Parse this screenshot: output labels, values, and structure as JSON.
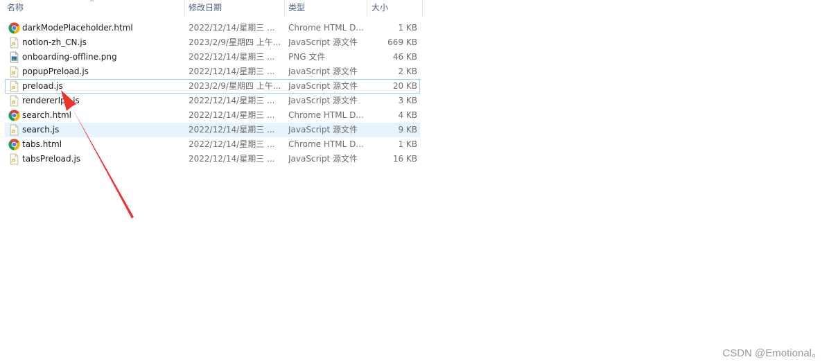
{
  "columns": {
    "name": "名称",
    "date": "修改日期",
    "type": "类型",
    "size": "大小"
  },
  "files": [
    {
      "name": "darkModePlaceholder.html",
      "date": "2022/12/14/星期三 ...",
      "type": "Chrome HTML D...",
      "size": "1 KB",
      "icon": "chrome-icon"
    },
    {
      "name": "notion-zh_CN.js",
      "date": "2023/2/9/星期四 上午...",
      "type": "JavaScript 源文件",
      "size": "669 KB",
      "icon": "js-file-icon"
    },
    {
      "name": "onboarding-offline.png",
      "date": "2022/12/14/星期三 ...",
      "type": "PNG 文件",
      "size": "46 KB",
      "icon": "image-file-icon"
    },
    {
      "name": "popupPreload.js",
      "date": "2022/12/14/星期三 ...",
      "type": "JavaScript 源文件",
      "size": "2 KB",
      "icon": "js-file-icon"
    },
    {
      "name": "preload.js",
      "date": "2023/2/9/星期四 上午...",
      "type": "JavaScript 源文件",
      "size": "20 KB",
      "icon": "js-file-icon",
      "state": "focus"
    },
    {
      "name": "rendererIpc.js",
      "date": "2022/12/14/星期三 ...",
      "type": "JavaScript 源文件",
      "size": "3 KB",
      "icon": "js-file-icon"
    },
    {
      "name": "search.html",
      "date": "2022/12/14/星期三 ...",
      "type": "Chrome HTML D...",
      "size": "4 KB",
      "icon": "chrome-icon"
    },
    {
      "name": "search.js",
      "date": "2022/12/14/星期三 ...",
      "type": "JavaScript 源文件",
      "size": "9 KB",
      "icon": "js-file-icon",
      "state": "hover"
    },
    {
      "name": "tabs.html",
      "date": "2022/12/14/星期三 ...",
      "type": "Chrome HTML D...",
      "size": "1 KB",
      "icon": "chrome-icon"
    },
    {
      "name": "tabsPreload.js",
      "date": "2022/12/14/星期三 ...",
      "type": "JavaScript 源文件",
      "size": "16 KB",
      "icon": "js-file-icon"
    }
  ],
  "annotation": {
    "color": "#f0302a"
  },
  "watermark": "CSDN @Emotional。"
}
